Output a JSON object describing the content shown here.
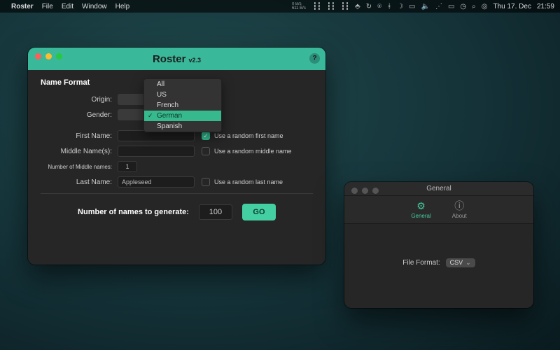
{
  "menubar": {
    "app": "Roster",
    "items": [
      "File",
      "Edit",
      "Window",
      "Help"
    ],
    "net_up": "0 B/s",
    "net_down": "611 B/s",
    "date": "Thu 17. Dec",
    "time": "21:59"
  },
  "main_window": {
    "title": "Roster",
    "version": "v2.3",
    "section_title": "Name Format",
    "rows": {
      "origin_label": "Origin:",
      "gender_label": "Gender:",
      "first_label": "First Name:",
      "middle_label": "Middle Name(s):",
      "middle_count_label": "Number of Middle names:",
      "middle_count_value": "1",
      "last_label": "Last Name:",
      "last_value": "Appleseed"
    },
    "checkboxes": {
      "first": {
        "label": "Use a random first name",
        "checked": true
      },
      "middle": {
        "label": "Use a random middle name",
        "checked": false
      },
      "last": {
        "label": "Use a random last name",
        "checked": false
      }
    },
    "generate_prompt": "Number of names to generate:",
    "generate_count": "100",
    "go_label": "GO",
    "dropdown": {
      "options": [
        "All",
        "US",
        "French",
        "German",
        "Spanish"
      ],
      "selected": "German"
    }
  },
  "pref_window": {
    "title": "General",
    "tabs": {
      "general": "General",
      "about": "About"
    },
    "field_label": "File Format:",
    "field_value": "CSV"
  }
}
